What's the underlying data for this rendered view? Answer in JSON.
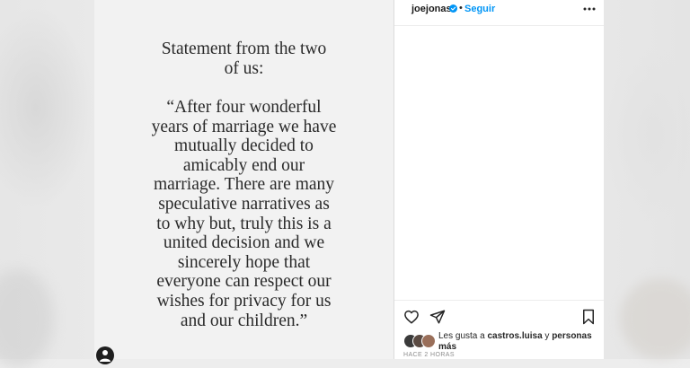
{
  "post": {
    "statement_title": "Statement from the two\nof us:",
    "statement_body": "“After four wonderful\nyears of marriage we have\nmutually decided to\namicably end our\nmarriage. There are many\nspeculative narratives as\nto why but, truly this is a\nunited decision and we\nsincerely hope that\neveryone can respect our\nwishes for privacy for us\nand our children.”"
  },
  "header": {
    "username": "joejonas",
    "separator": "•",
    "follow_label": "Seguir",
    "more_icon": "more-horizontal-icon"
  },
  "actions": {
    "like_icon": "heart-icon",
    "share_icon": "paper-plane-icon",
    "save_icon": "bookmark-icon"
  },
  "likes": {
    "prefix": "Les gusta a ",
    "user": "castros.luisa",
    "middle": " y ",
    "suffix": "personas más"
  },
  "timestamp": "HACE 2 HORAS",
  "colors": {
    "accent": "#0095f6",
    "text": "#262626",
    "muted": "#8e8e8e"
  }
}
